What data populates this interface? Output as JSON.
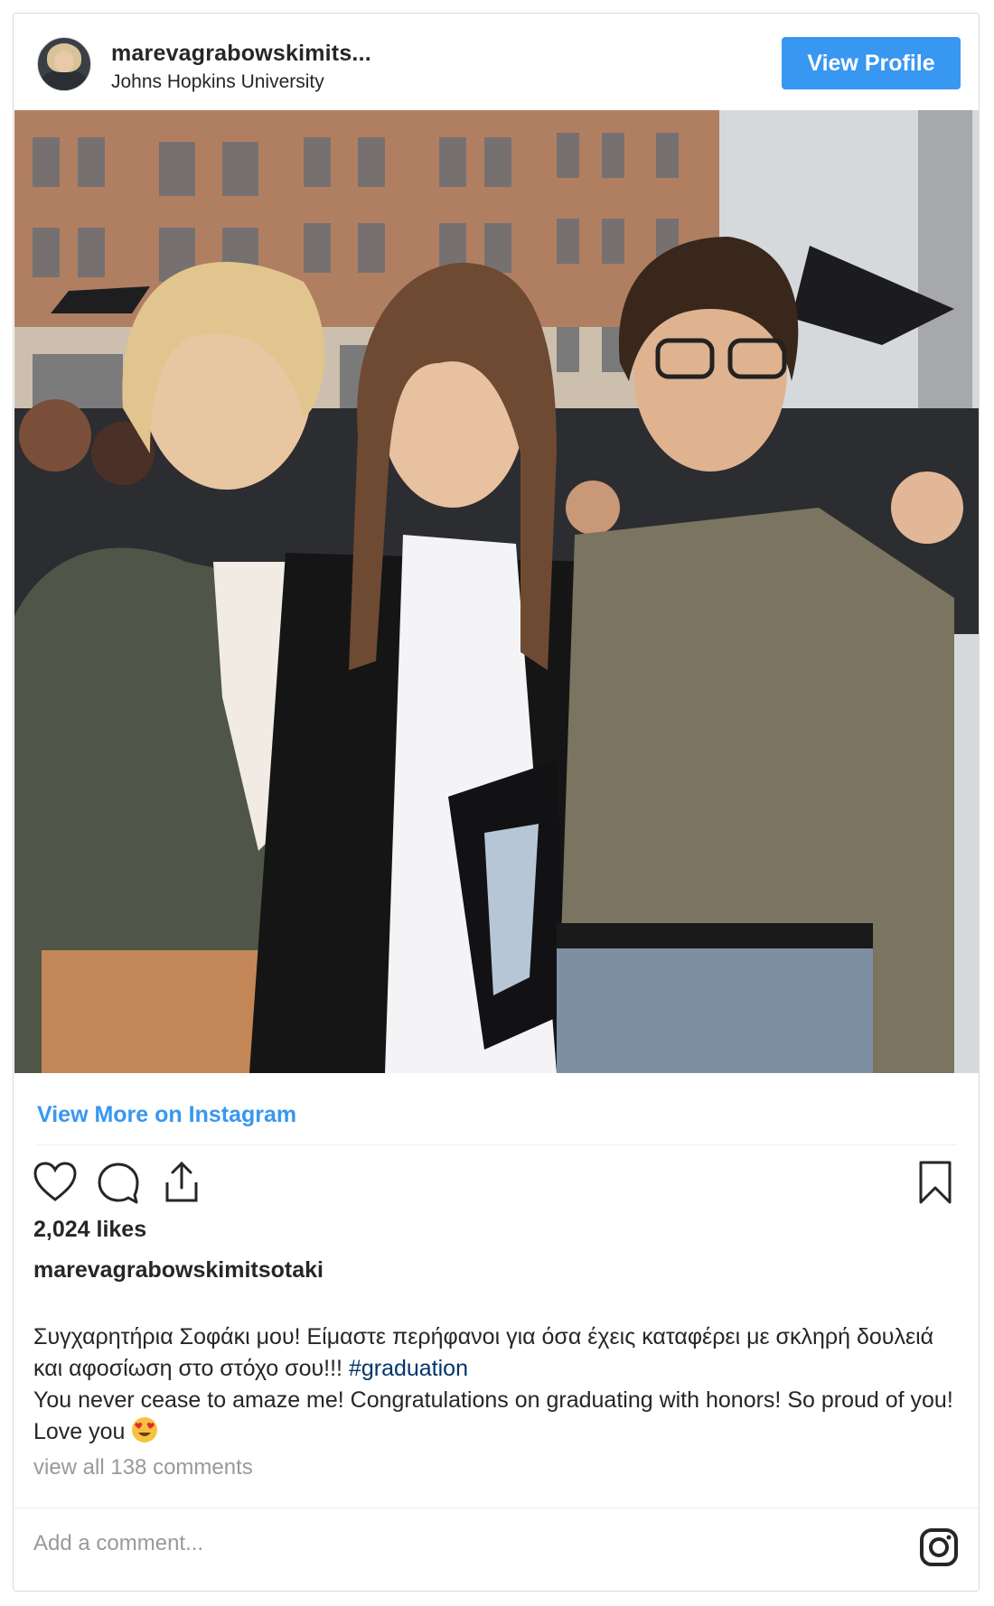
{
  "header": {
    "username": "marevagrabowskimits...",
    "location": "Johns Hopkins University",
    "view_profile_label": "View Profile"
  },
  "post": {
    "view_more_label": "View More on Instagram",
    "likes": "2,024 likes",
    "author": "marevagrabowskimitsotaki",
    "caption_greek": "Συγχαρητήρια Σοφάκι μου! Είμαστε περήφανοι για όσα έχεις καταφέρει με σκληρή δουλειά και αφοσίωση στο στόχο σου!!! ",
    "hashtag": "#graduation",
    "caption_english": "You never cease to amaze me! Congratulations on graduating with honors! So proud of you! Love you ",
    "view_comments": "view all 138 comments",
    "add_comment_placeholder": "Add a comment..."
  },
  "icons": {
    "like": "heart-icon",
    "comment": "comment-icon",
    "share": "share-icon",
    "save": "bookmark-icon",
    "brand": "instagram-icon",
    "emoji": "heart-eyes-emoji"
  },
  "colors": {
    "accent": "#3897f0",
    "hashtag": "#003569",
    "muted": "#999999"
  }
}
